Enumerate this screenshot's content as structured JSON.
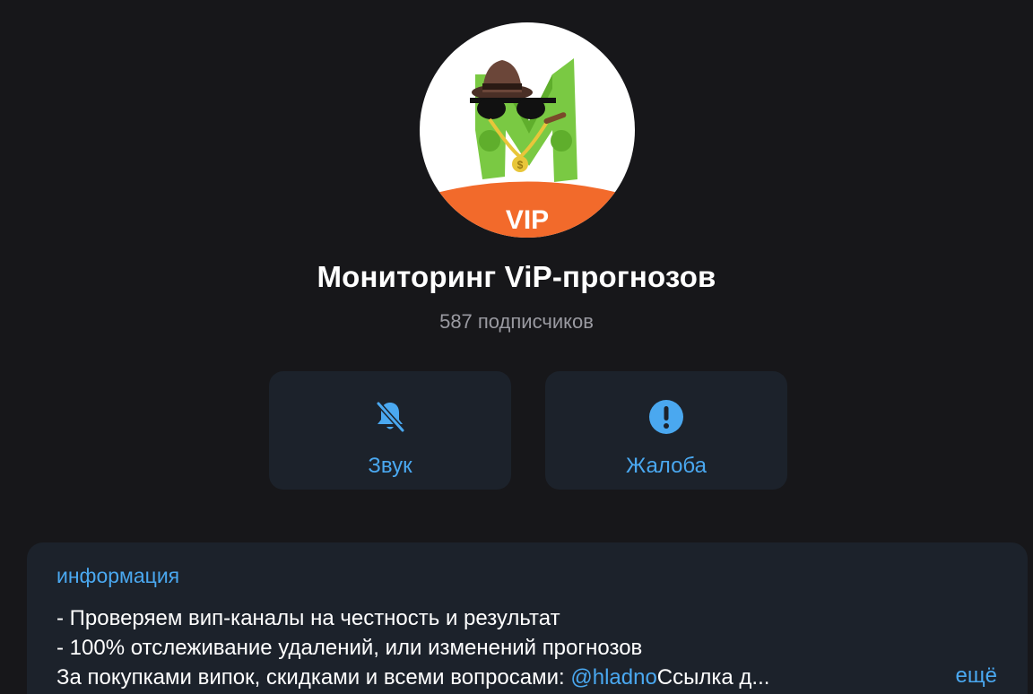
{
  "channel": {
    "avatar_badge": "VIP",
    "title": "Мониторинг ViP-прогнозов",
    "subscribers": "587 подписчиков"
  },
  "actions": [
    {
      "label": "Звук",
      "icon": "bell-slash-icon"
    },
    {
      "label": "Жалоба",
      "icon": "exclamation-circle-icon"
    }
  ],
  "info": {
    "header": "информация",
    "line1": "- Проверяем вип-каналы на честность и результат",
    "line2": "- 100% отслеживание удалений, или изменений прогнозов",
    "line3_prefix": "За покупками випок, скидками и всеми вопросами: ",
    "line3_link": "@hladno",
    "line3_suffix": "Ссылка д...",
    "more": "ещё"
  },
  "colors": {
    "background": "#17171a",
    "card": "#1c222b",
    "accent": "#4aa8f0",
    "avatar_green": "#7ac943",
    "avatar_orange": "#f26a2b"
  }
}
